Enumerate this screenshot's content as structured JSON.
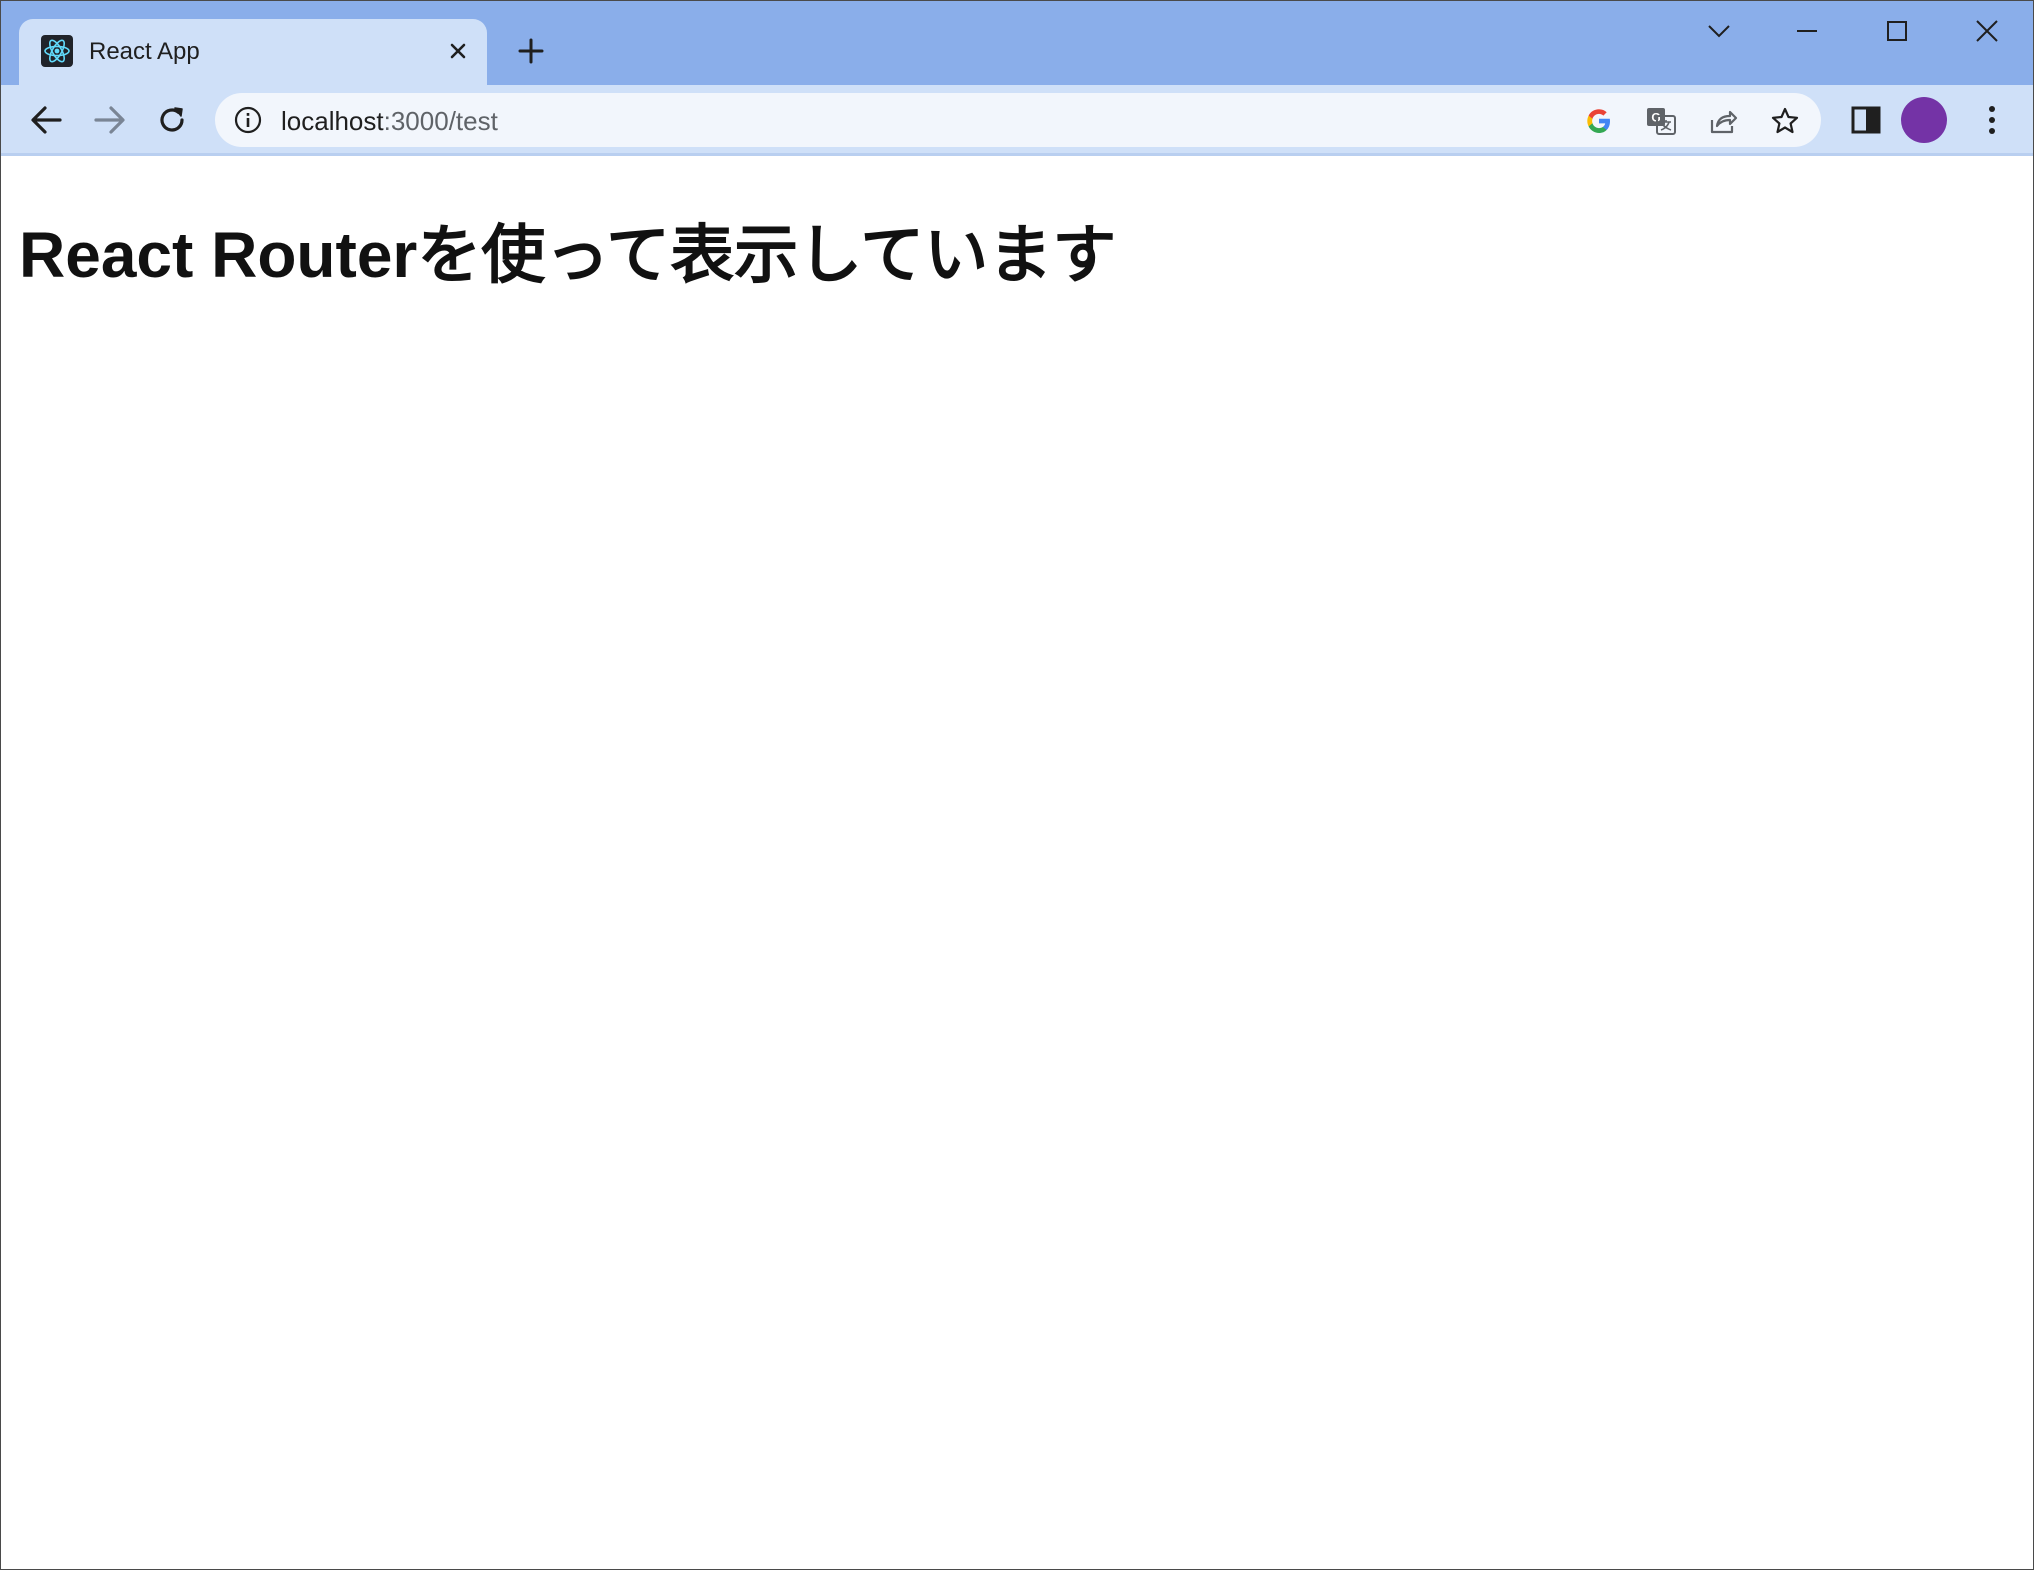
{
  "browser": {
    "tab": {
      "title": "React App",
      "favicon": "react-logo-icon"
    },
    "new_tab_icon": "plus-icon",
    "window_controls": [
      "tab-search-icon",
      "minimize-icon",
      "maximize-icon",
      "close-icon"
    ],
    "toolbar": {
      "back_icon": "back-arrow-icon",
      "forward_icon": "forward-arrow-icon",
      "reload_icon": "reload-icon",
      "site_info_icon": "info-icon",
      "address": {
        "host": "localhost",
        "path": ":3000/test"
      },
      "omnibox_icons": [
        "google-icon",
        "translate-icon",
        "share-icon",
        "bookmark-star-icon"
      ],
      "side_panel_icon": "side-panel-icon",
      "profile_color": "#7433a6",
      "menu_icon": "kebab-menu-icon"
    },
    "colors": {
      "tabstrip": "#8aaeea",
      "toolbar": "#cfe0f8",
      "omnibox": "#f2f6fc"
    }
  },
  "page": {
    "heading": "React Routerを使って表示しています"
  }
}
